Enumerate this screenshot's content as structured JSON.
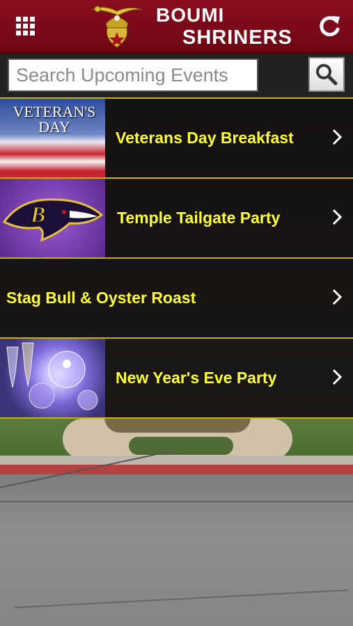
{
  "header": {
    "title_line1": "BOUMI",
    "title_line2": "SHRINERS"
  },
  "search": {
    "placeholder": "Search Upcoming Events"
  },
  "events": [
    {
      "title": "Veterans Day Breakfast",
      "thumb_text_1": "VETERAN'S",
      "thumb_text_2": "DAY"
    },
    {
      "title": "Temple Tailgate Party"
    },
    {
      "title": "Stag Bull & Oyster Roast"
    },
    {
      "title": "New Year's Eve Party"
    }
  ],
  "colors": {
    "header": "#7a0a1a",
    "accent": "#ffff33",
    "divider": "#c8b400"
  }
}
